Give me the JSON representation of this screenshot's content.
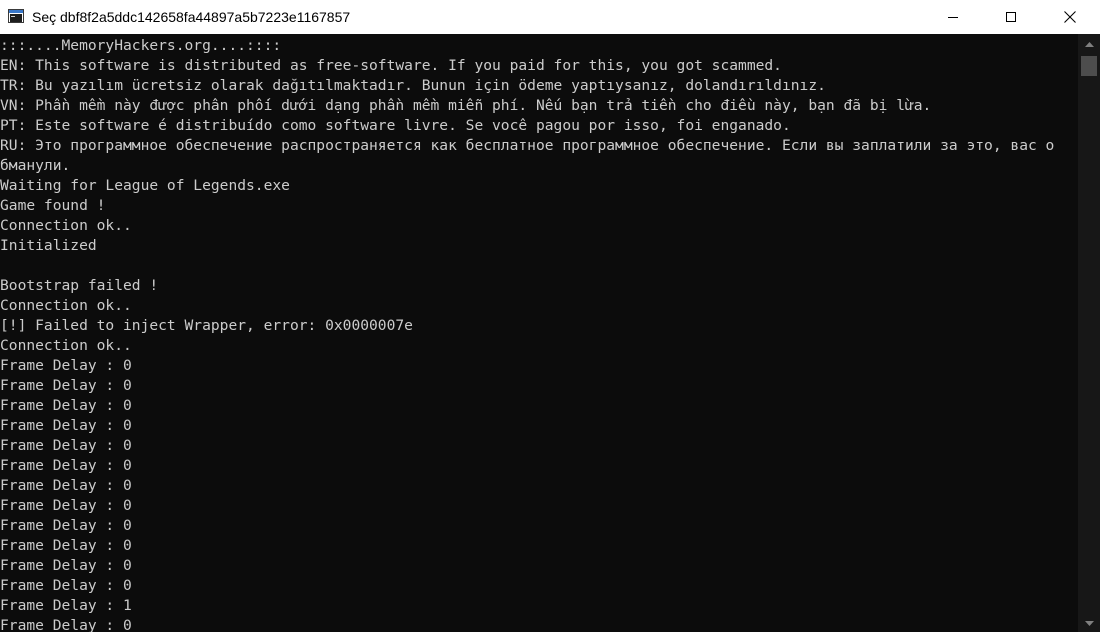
{
  "window": {
    "title": "Seç dbf8f2a5ddc142658fa44897a5b7223e1167857",
    "icon": "console-app-icon",
    "controls": {
      "minimize": "minimize-icon",
      "maximize": "maximize-icon",
      "close": "close-icon"
    }
  },
  "console": {
    "foreground": "#cccccc",
    "background": "#0c0c0c",
    "lines": [
      ":::....MemoryHackers.org....::::",
      "EN: This software is distributed as free-software. If you paid for this, you got scammed.",
      "TR: Bu yazılım ücretsiz olarak dağıtılmaktadır. Bunun için ödeme yaptıysanız, dolandırıldınız.",
      "VN: Phần mềm này được phân phối dưới dạng phần mềm miễn phí. Nếu bạn trả tiền cho điều này, bạn đã bị lừa.",
      "PT: Este software é distribuído como software livre. Se você pagou por isso, foi enganado.",
      "RU: Это программное обеспечение распространяется как бесплатное программное обеспечение. Если вы заплатили за это, вас о",
      "бманули.",
      "Waiting for League of Legends.exe",
      "Game found !",
      "Connection ok..",
      "Initialized",
      "",
      "Bootstrap failed !",
      "Connection ok..",
      "[!] Failed to inject Wrapper, error: 0x0000007e",
      "Connection ok..",
      "Frame Delay : 0",
      "Frame Delay : 0",
      "Frame Delay : 0",
      "Frame Delay : 0",
      "Frame Delay : 0",
      "Frame Delay : 0",
      "Frame Delay : 0",
      "Frame Delay : 0",
      "Frame Delay : 0",
      "Frame Delay : 0",
      "Frame Delay : 0",
      "Frame Delay : 0",
      "Frame Delay : 1",
      "Frame Delay : 0"
    ]
  },
  "scrollbar": {
    "up_icon": "scroll-up-arrow-icon",
    "down_icon": "scroll-down-arrow-icon"
  }
}
